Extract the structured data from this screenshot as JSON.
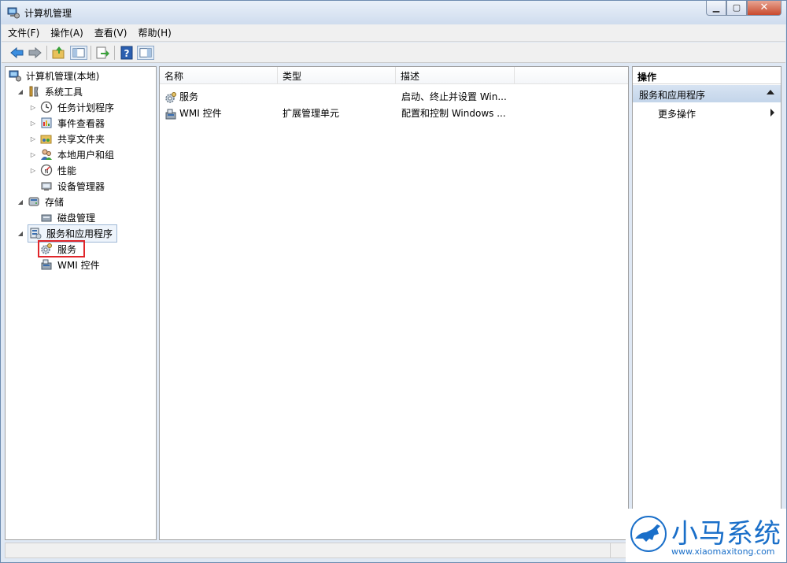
{
  "window": {
    "title": "计算机管理"
  },
  "menu": [
    "文件(F)",
    "操作(A)",
    "查看(V)",
    "帮助(H)"
  ],
  "tree": [
    {
      "label": "计算机管理(本地)",
      "icon": "computer-manage-icon",
      "expander": ""
    },
    {
      "label": "系统工具",
      "icon": "tools-icon",
      "expander": "◢"
    },
    {
      "label": "任务计划程序",
      "icon": "clock-icon",
      "expander": "▷"
    },
    {
      "label": "事件查看器",
      "icon": "event-viewer-icon",
      "expander": "▷"
    },
    {
      "label": "共享文件夹",
      "icon": "shared-folder-icon",
      "expander": "▷"
    },
    {
      "label": "本地用户和组",
      "icon": "users-icon",
      "expander": "▷"
    },
    {
      "label": "性能",
      "icon": "performance-icon",
      "expander": "▷"
    },
    {
      "label": "设备管理器",
      "icon": "device-manager-icon",
      "expander": ""
    },
    {
      "label": "存储",
      "icon": "storage-icon",
      "expander": "◢"
    },
    {
      "label": "磁盘管理",
      "icon": "disk-icon",
      "expander": ""
    },
    {
      "label": "服务和应用程序",
      "icon": "services-apps-icon",
      "expander": "◢"
    },
    {
      "label": "服务",
      "icon": "gear-services-icon",
      "expander": ""
    },
    {
      "label": "WMI 控件",
      "icon": "wmi-icon",
      "expander": ""
    }
  ],
  "list": {
    "columns": [
      "名称",
      "类型",
      "描述"
    ],
    "rows": [
      {
        "name": "服务",
        "type": "",
        "desc": "启动、终止并设置 Win...",
        "icon": "gear-services-icon"
      },
      {
        "name": "WMI 控件",
        "type": "扩展管理单元",
        "desc": "配置和控制 Windows ...",
        "icon": "wmi-icon"
      }
    ]
  },
  "actions": {
    "header": "操作",
    "group": "服务和应用程序",
    "item": "更多操作"
  },
  "watermark": {
    "brand": "小马系统",
    "url": "www.xiaomaxitong.com"
  },
  "colors": {
    "highlight": "#e0262b",
    "accent": "#1a6fc9"
  }
}
